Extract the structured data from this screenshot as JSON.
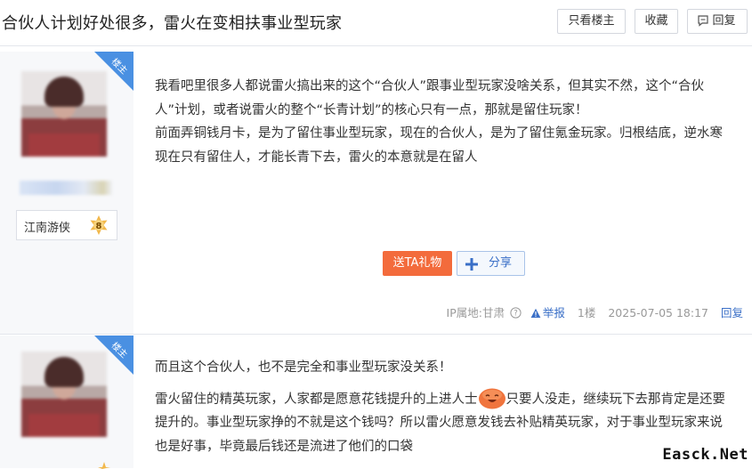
{
  "header": {
    "title": "合伙人计划好处很多，雷火在变相扶事业型玩家",
    "only_op_label": "只看楼主",
    "favorite_label": "收藏",
    "reply_label": "回复"
  },
  "posts": [
    {
      "badge": "楼主",
      "level_name": "江南游侠",
      "level_num": "8",
      "paragraphs": [
        "我看吧里很多人都说雷火搞出来的这个“合伙人”跟事业型玩家没啥关系，但其实不然，这个“合伙人”计划，或者说雷火的整个“长青计划”的核心只有一点，那就是留住玩家！",
        "前面弄铜钱月卡，是为了留住事业型玩家，现在的合伙人，是为了留住氪金玩家。归根结底，逆水寒现在只有留住人，才能长青下去，雷火的本意就是在留人"
      ],
      "gift_label": "送TA礼物",
      "share_label": "分享",
      "ip_location": "IP属地:甘肃",
      "report_label": "举报",
      "floor": "1楼",
      "time": "2025-07-05 18:17",
      "reply_label": "回复"
    },
    {
      "badge": "楼主",
      "paragraphs": [
        "而且这个合伙人，也不是完全和事业型玩家没关系！",
        "雷火留住的精英玩家，人家都是愿意花钱提升的上进人士",
        "只要人没走，继续玩下去那肯定是还要提升的。事业型玩家挣的不就是这个钱吗？所以雷火愿意发钱去补贴精英玩家，对于事业型玩家来说也是好事，毕竟最后钱还是流进了他们的口袋"
      ]
    }
  ],
  "watermark": "Easck.Net",
  "colors": {
    "accent_blue": "#3a6fc7",
    "gift_orange": "#f36b3c",
    "badge_blue": "#4a90e2",
    "sidebar_bg": "#f7f8fa"
  }
}
